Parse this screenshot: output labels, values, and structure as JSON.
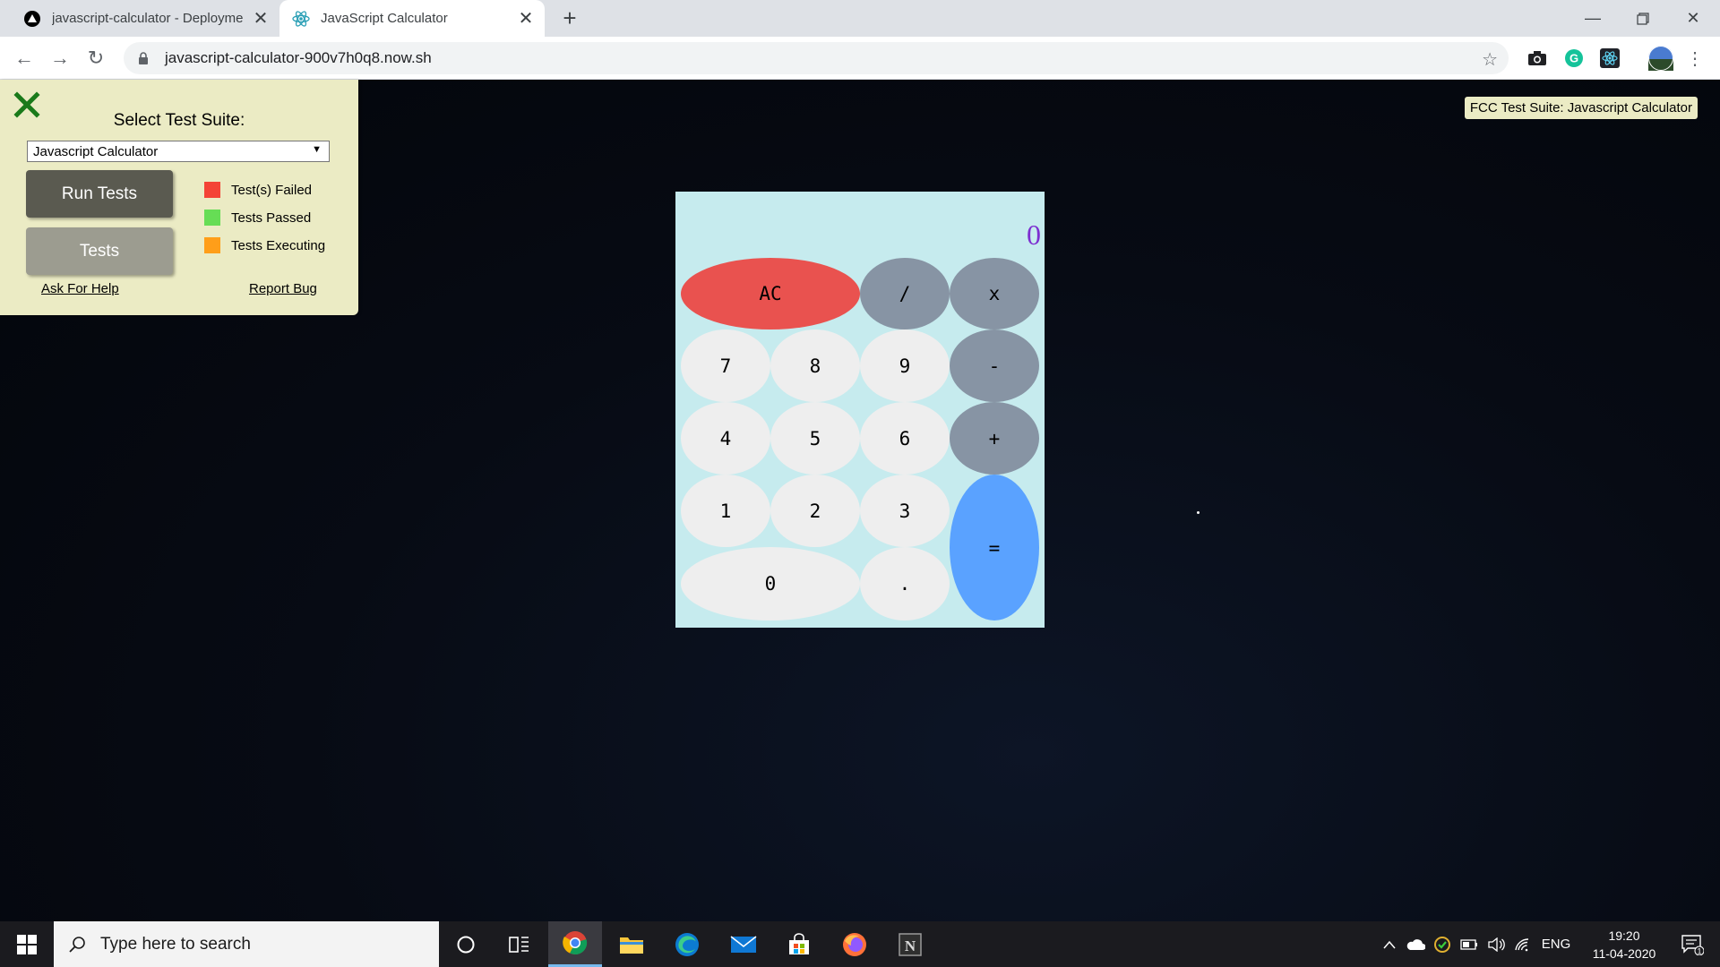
{
  "browser": {
    "tabs": [
      {
        "title": "javascript-calculator - Deployme",
        "active": false,
        "favicon": "vercel-triangle-icon"
      },
      {
        "title": "JavaScript Calculator",
        "active": true,
        "favicon": "react-atom-icon"
      }
    ],
    "url": "javascript-calculator-900v7h0q8.now.sh"
  },
  "fcc_panel": {
    "heading": "Select Test Suite:",
    "suite_selected": "Javascript Calculator",
    "run_tests_label": "Run Tests",
    "tests_label": "Tests",
    "legend": [
      {
        "label": "Test(s) Failed",
        "color": "#f44336"
      },
      {
        "label": "Tests Passed",
        "color": "#66dd55"
      },
      {
        "label": "Tests Executing",
        "color": "#ff9e19"
      }
    ],
    "help_link": "Ask For Help",
    "bug_link": "Report Bug",
    "badge": "FCC Test Suite: Javascript Calculator"
  },
  "calculator": {
    "display": "0",
    "keys": {
      "clear": "AC",
      "divide": "/",
      "multiply": "x",
      "subtract": "-",
      "add": "+",
      "equals": "=",
      "seven": "7",
      "eight": "8",
      "nine": "9",
      "four": "4",
      "five": "5",
      "six": "6",
      "one": "1",
      "two": "2",
      "three": "3",
      "zero": "0",
      "decimal": "."
    }
  },
  "taskbar": {
    "search_placeholder": "Type here to search",
    "language": "ENG",
    "time": "19:20",
    "date": "11-04-2020",
    "notification_count": "1"
  }
}
